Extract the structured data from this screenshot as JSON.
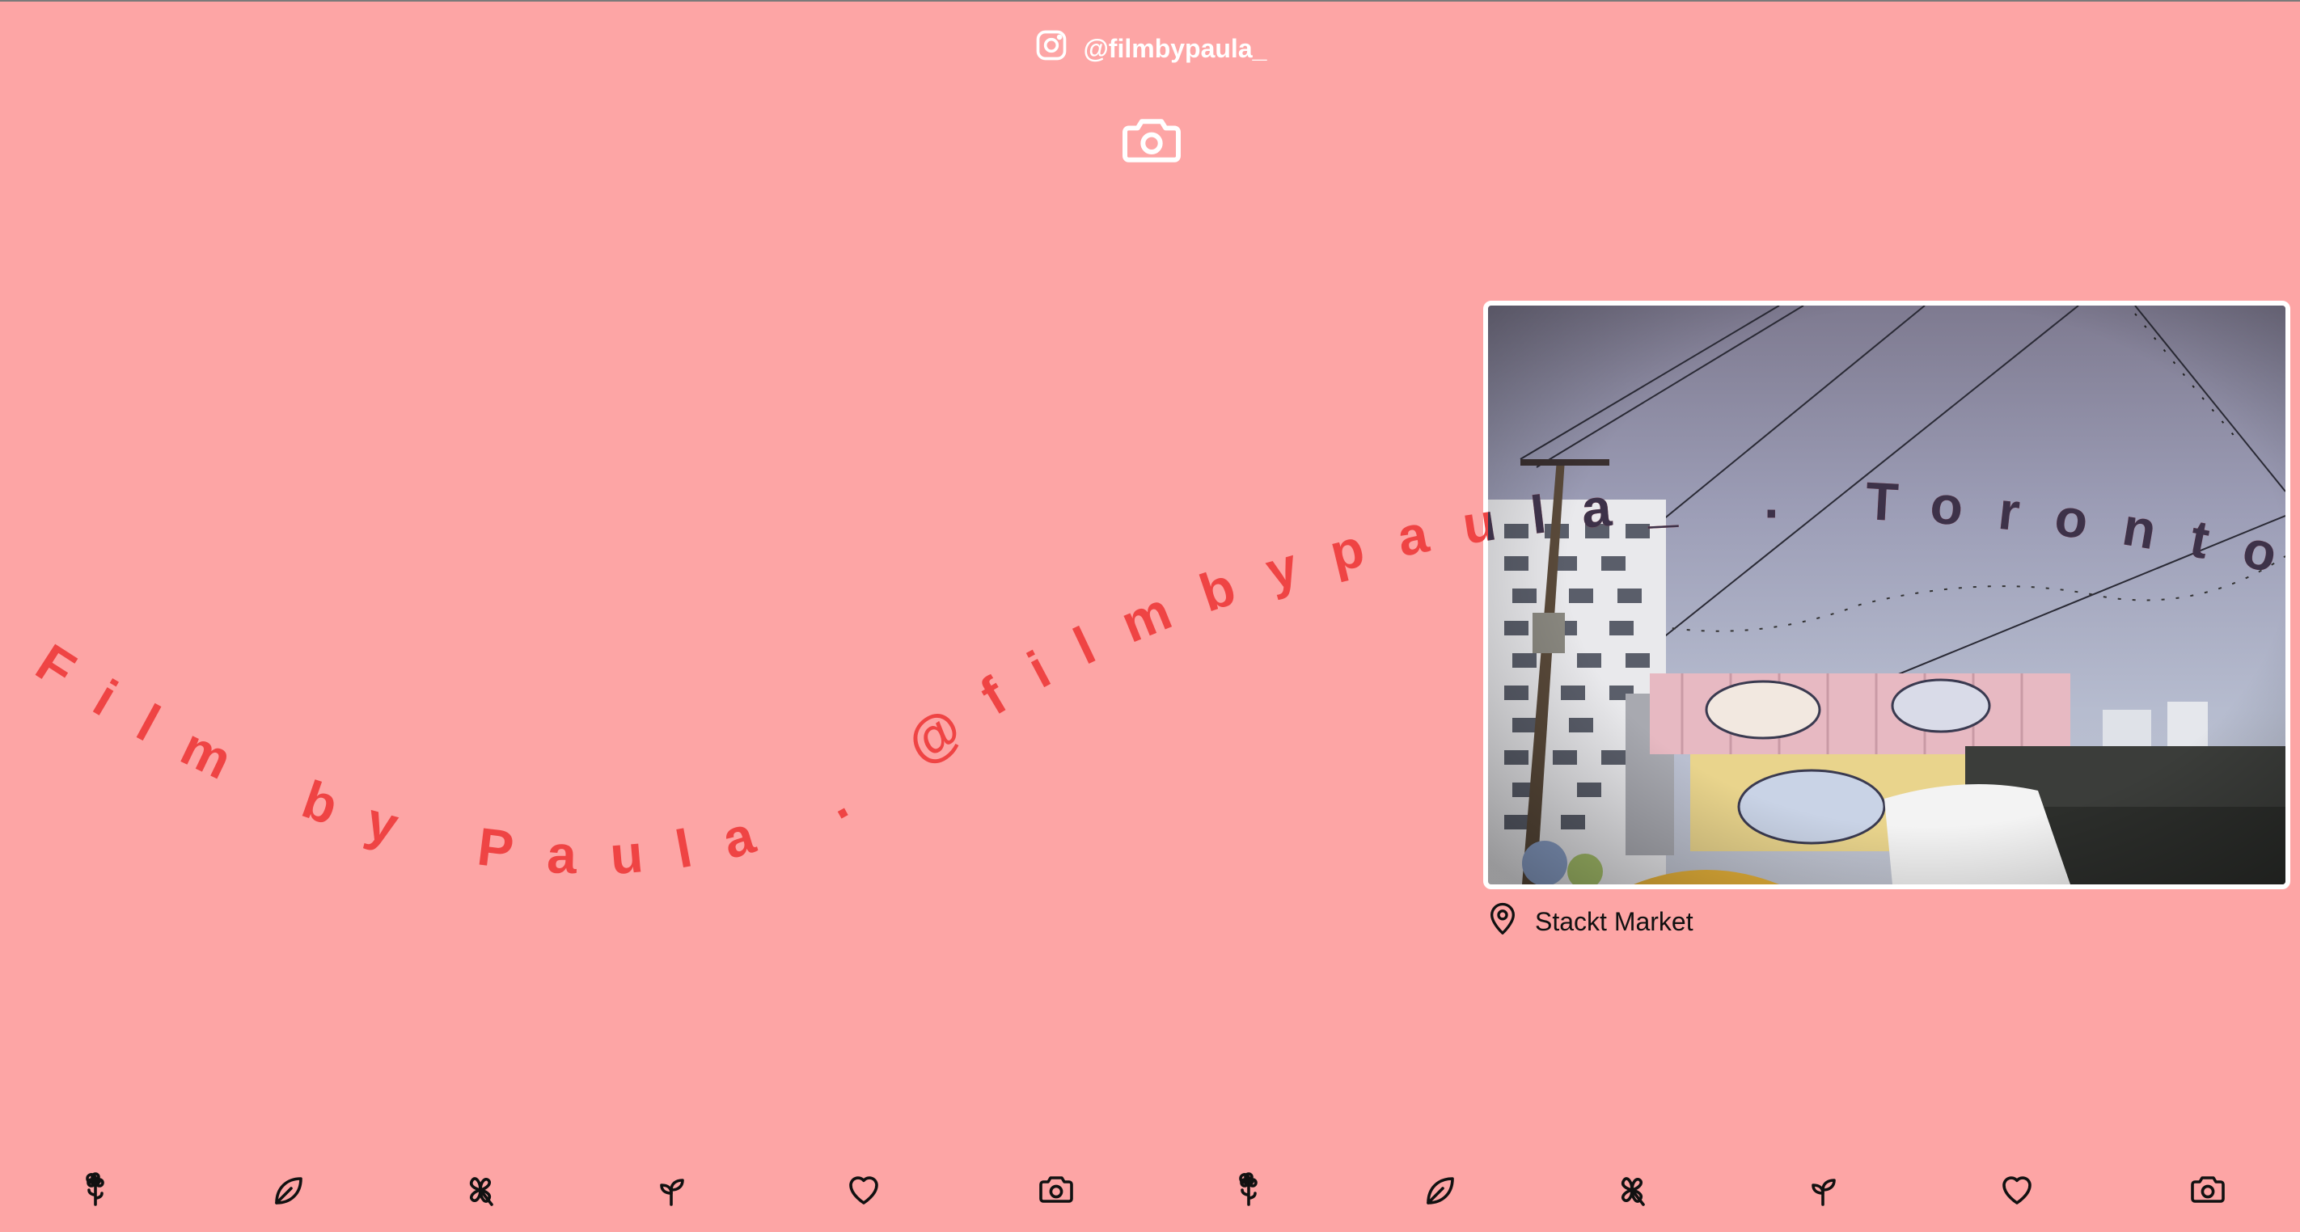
{
  "header": {
    "handle": "@filmbypaula_",
    "instagram_icon": "instagram-icon",
    "camera_icon": "camera-icon"
  },
  "curved_text": "Film by Paula  .  @filmbypaula_  .  Toronto",
  "photo": {
    "alt": "Stackt Market",
    "location_icon": "map-pin-icon",
    "location": "Stackt Market"
  },
  "footer_icons": [
    "flower-icon",
    "leaf-icon",
    "clover-icon",
    "sprout-icon",
    "heart-icon",
    "camera-icon",
    "flower-icon",
    "leaf-icon",
    "clover-icon",
    "sprout-icon",
    "heart-icon",
    "camera-icon"
  ],
  "colors": {
    "background": "#fda5a5",
    "curved_text": "#ef4444",
    "curved_text_on_photo": "#1f2f4a",
    "header_text": "#ffffff",
    "location_text": "#111111"
  }
}
